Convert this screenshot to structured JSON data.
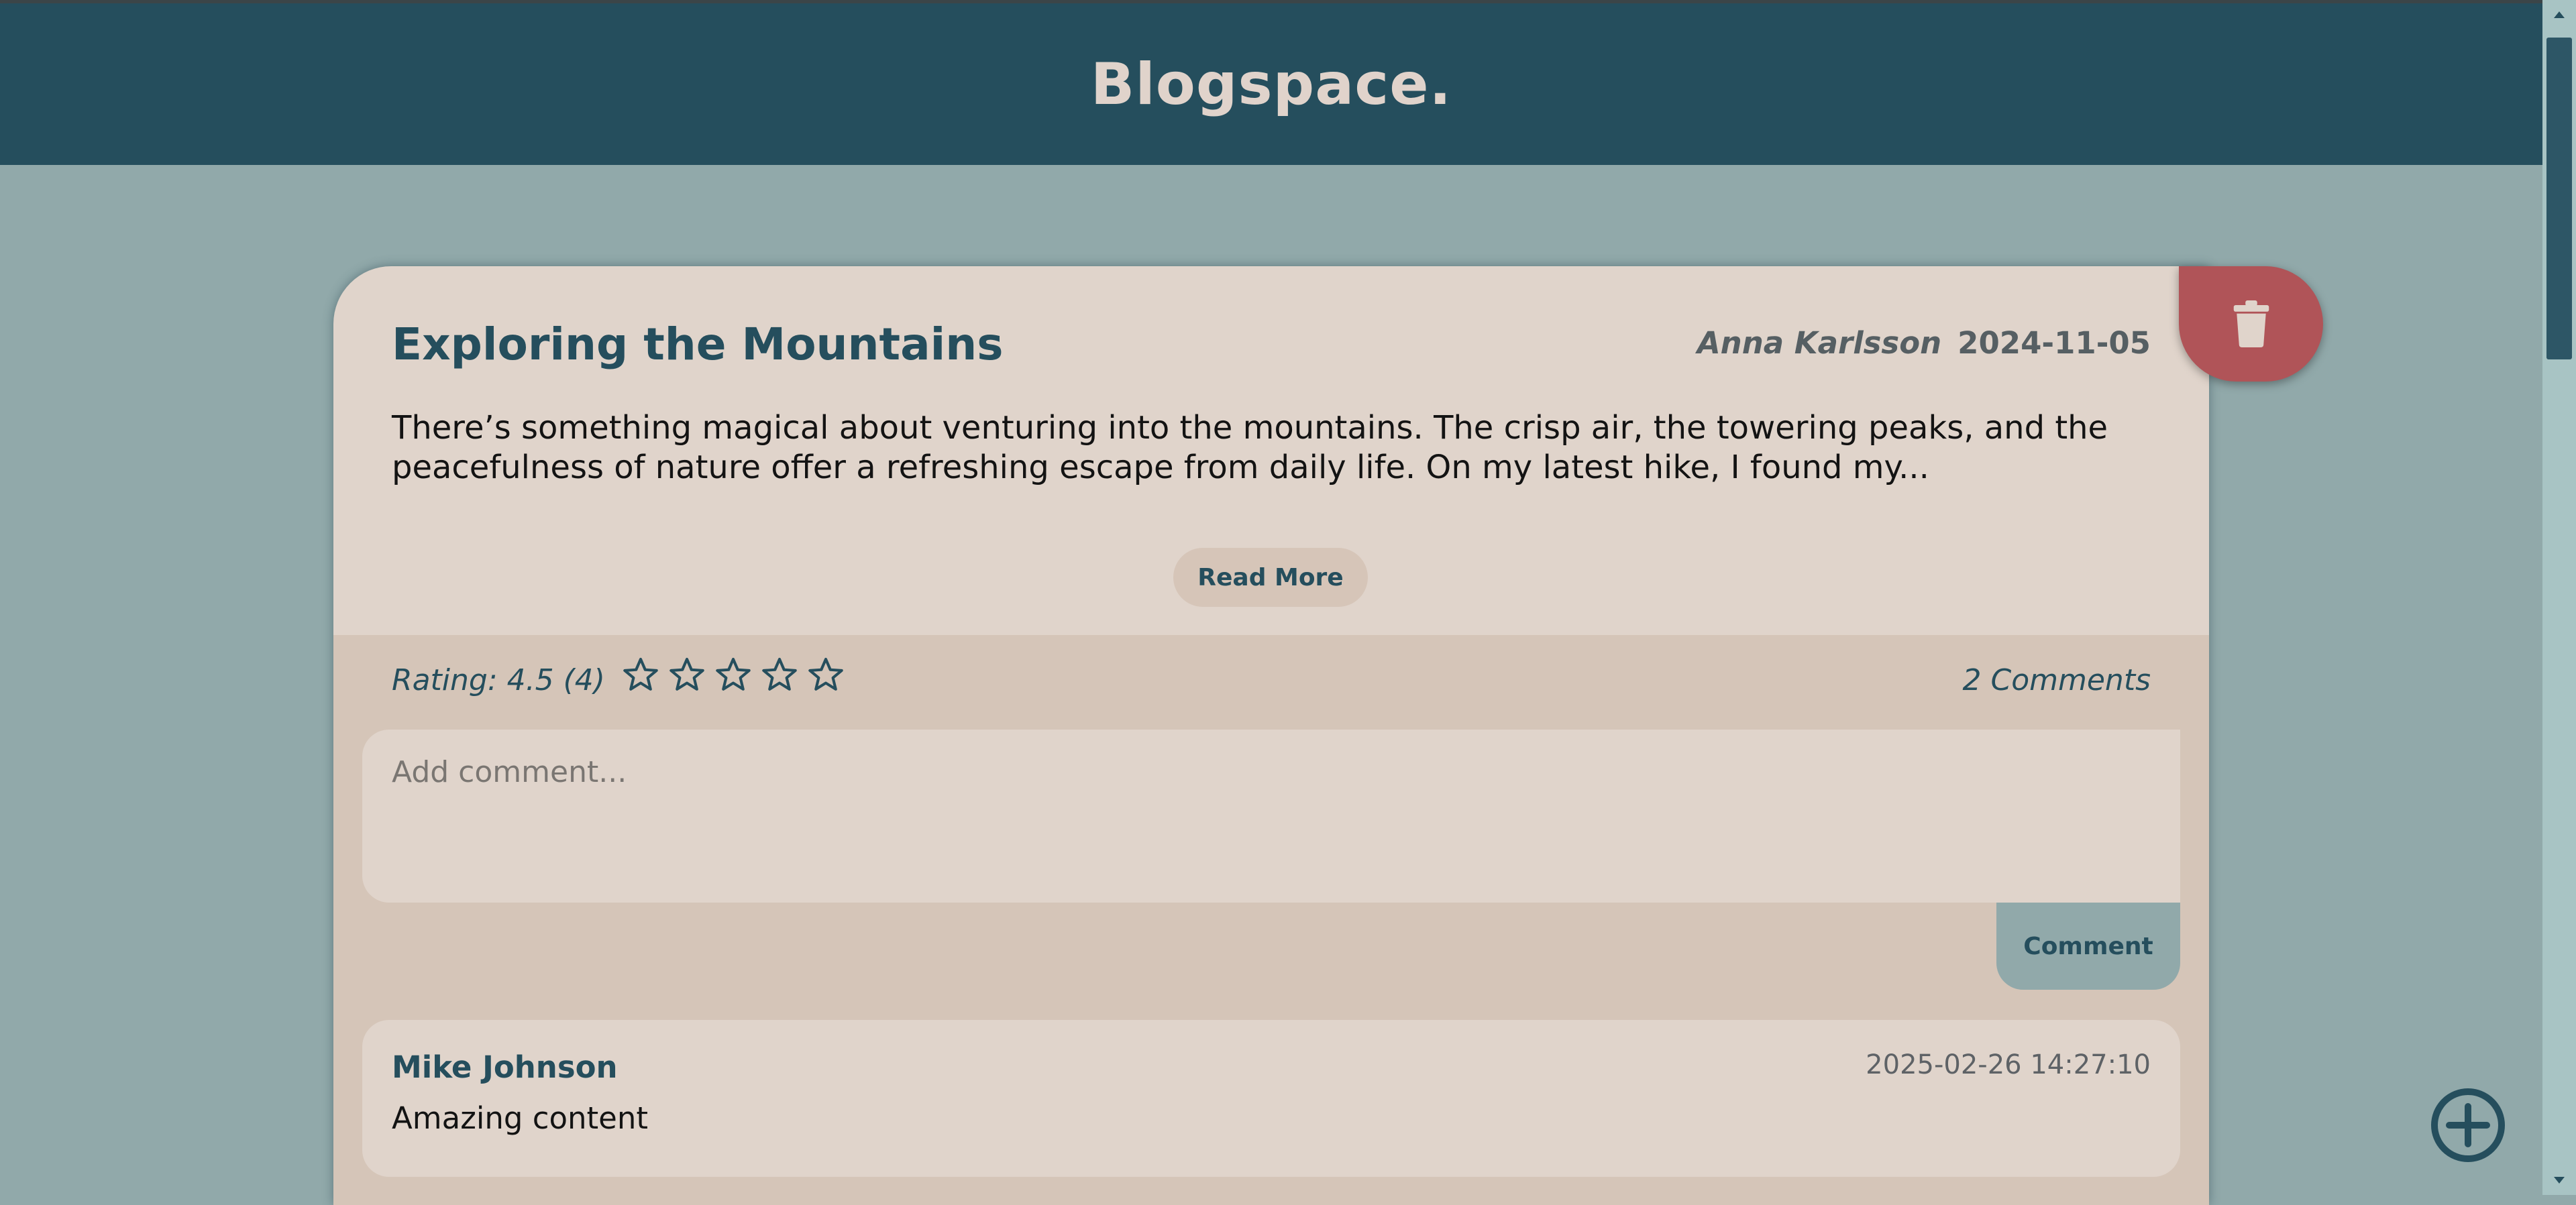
{
  "app": {
    "title": "Blogspace."
  },
  "post": {
    "title": "Exploring the Mountains",
    "author": "Anna Karlsson",
    "date": "2024-11-05",
    "excerpt": "There’s something magical about venturing into the mountains. The crisp air, the towering peaks, and the peacefulness of nature offer a refreshing escape from daily life. On my latest hike, I found my...",
    "read_more_label": "Read More",
    "rating_text": "Rating: 4.5 (4)",
    "stars": 5,
    "comment_count_text": "2 Comments"
  },
  "comment_form": {
    "placeholder": "Add comment...",
    "value": "",
    "button_label": "Comment"
  },
  "comments": [
    {
      "author": "Mike Johnson",
      "timestamp": "2025-02-26 14:27:10",
      "text": "Amazing content"
    }
  ],
  "icons": {
    "delete": "trash-icon",
    "add": "plus-circle-icon",
    "star": "star-outline-icon"
  },
  "colors": {
    "header": "#254e5d",
    "background": "#91a9aa",
    "card": "#e0d4cb",
    "card_lower": "#d5c5b8",
    "accent": "#254e5d",
    "delete": "#b05458"
  }
}
